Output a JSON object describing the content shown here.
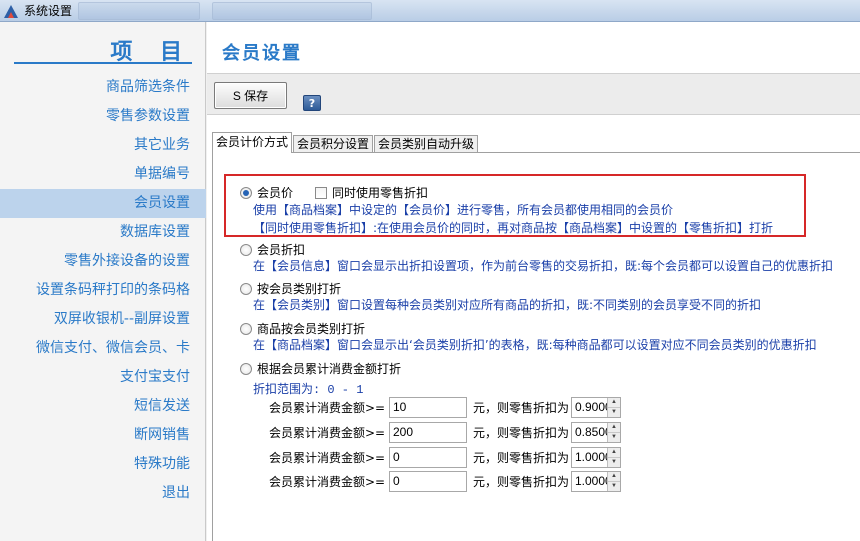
{
  "window": {
    "title": "系统设置"
  },
  "sidebar": {
    "heading": "项 目",
    "items": [
      {
        "label": "商品筛选条件"
      },
      {
        "label": "零售参数设置"
      },
      {
        "label": "其它业务"
      },
      {
        "label": "单据编号"
      },
      {
        "label": "会员设置",
        "active": true
      },
      {
        "label": "数据库设置"
      },
      {
        "label": "零售外接设备的设置"
      },
      {
        "label": "设置条码秤打印的条码格"
      },
      {
        "label": "双屏收银机--副屏设置"
      },
      {
        "label": "微信支付、微信会员、卡"
      },
      {
        "label": "支付宝支付"
      },
      {
        "label": "短信发送"
      },
      {
        "label": "断网销售"
      },
      {
        "label": "特殊功能"
      },
      {
        "label": "退出"
      }
    ]
  },
  "main": {
    "page_title": "会员设置",
    "toolbar": {
      "save_label": "S 保存",
      "help_label": "?"
    },
    "tabs": [
      {
        "label": "会员计价方式",
        "active": true
      },
      {
        "label": "会员积分设置"
      },
      {
        "label": "会员类别自动升级"
      }
    ],
    "options": {
      "member_price": {
        "label": "会员价",
        "checked": true,
        "checkbox_label": "同时使用零售折扣",
        "checkbox_checked": false,
        "desc1": "使用【商品档案】中设定的【会员价】进行零售，所有会员都使用相同的会员价",
        "desc2": "【同时使用零售折扣】:在使用会员价的同时，再对商品按【商品档案】中设置的【零售折扣】打折"
      },
      "member_discount": {
        "label": "会员折扣",
        "desc": "在【会员信息】窗口会显示出折扣设置项，作为前台零售的交易折扣，既:每个会员都可以设置自己的优惠折扣"
      },
      "category_discount": {
        "label": "按会员类别打折",
        "desc": "在【会员类别】窗口设置每种会员类别对应所有商品的折扣，既:不同类别的会员享受不同的折扣"
      },
      "product_category_discount": {
        "label": "商品按会员类别打折",
        "desc": "在【商品档案】窗口会显示出‘会员类别折扣’的表格，既:每种商品都可以设置对应不同会员类别的优惠折扣"
      },
      "cumulative_discount": {
        "label": "根据会员累计消费金额打折",
        "range_label": "折扣范围为: 0 - 1",
        "tier_label": "会员累计消费金额>=",
        "tier_mid": "元，则零售折扣为",
        "tiers": [
          {
            "amount": "10",
            "discount": "0.9000"
          },
          {
            "amount": "200",
            "discount": "0.8500"
          },
          {
            "amount": "0",
            "discount": "1.0000"
          },
          {
            "amount": "0",
            "discount": "1.0000"
          }
        ]
      }
    }
  },
  "colors": {
    "accent": "#2a7ac8",
    "desc_text": "#1a3fa8",
    "highlight_box": "#d62828",
    "sidebar_active": "#bcd3ec"
  }
}
